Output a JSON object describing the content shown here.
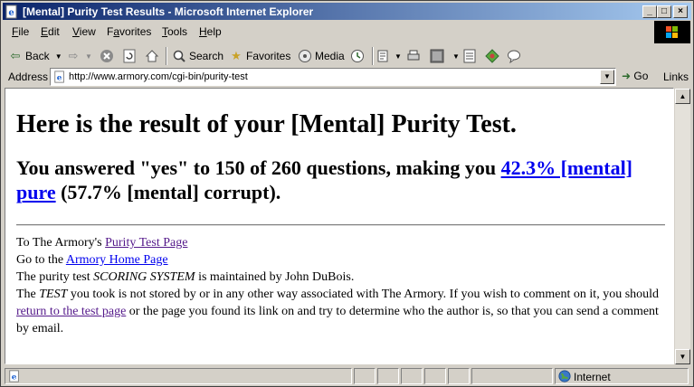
{
  "window": {
    "title": "[Mental] Purity Test Results - Microsoft Internet Explorer",
    "minimize": "_",
    "maximize": "□",
    "close": "×"
  },
  "menu": {
    "items": [
      {
        "label": "File",
        "accel": "F",
        "rest": "ile"
      },
      {
        "label": "Edit",
        "accel": "E",
        "rest": "dit"
      },
      {
        "label": "View",
        "accel": "V",
        "rest": "iew"
      },
      {
        "label": "Favorites",
        "accel": "a",
        "pre": "F",
        "rest": "vorites"
      },
      {
        "label": "Tools",
        "accel": "T",
        "rest": "ools"
      },
      {
        "label": "Help",
        "accel": "H",
        "rest": "elp"
      }
    ]
  },
  "toolbar": {
    "back_label": "Back",
    "search_label": "Search",
    "favorites_label": "Favorites",
    "media_label": "Media"
  },
  "address": {
    "label": "Address",
    "url": "http://www.armory.com/cgi-bin/purity-test",
    "go_label": "Go",
    "links_label": "Links"
  },
  "page": {
    "heading": "Here is the result of your [Mental] Purity Test.",
    "result_pre": "You answered \"yes\" to 150 of 260 questions, making you ",
    "result_link": "42.3% [mental] pure",
    "result_post": " (57.7% [mental] corrupt).",
    "line1_pre": "To The Armory's ",
    "line1_link": "Purity Test Page",
    "line2_pre": "Go to the ",
    "line2_link": "Armory Home Page",
    "line3_pre": "The purity test ",
    "line3_em": "SCORING SYSTEM",
    "line3_post": " is maintained by John DuBois.",
    "line4_pre": "The ",
    "line4_em": "TEST",
    "line4_mid": " you took is not stored by or in any other way associated with The Armory. If you wish to comment on it, you should ",
    "line4_link": "return to the test page",
    "line4_post": " or the page you found its link on and try to determine who the author is, so that you can send a comment by email."
  },
  "status": {
    "zone": "Internet"
  },
  "colors": {
    "titlebar_start": "#0a246a",
    "titlebar_end": "#a6caf0",
    "link": "#0000ee",
    "visited_link": "#551a8b",
    "chrome": "#d4d0c8"
  },
  "icons": [
    "ie-page-icon",
    "windows-logo-icon",
    "back-arrow-icon",
    "forward-arrow-icon",
    "stop-icon",
    "refresh-icon",
    "home-icon",
    "search-icon",
    "favorites-icon",
    "media-icon",
    "history-icon",
    "mail-icon",
    "print-icon",
    "edit-icon",
    "discuss-icon",
    "messenger-icon",
    "go-arrow-icon",
    "globe-icon"
  ]
}
